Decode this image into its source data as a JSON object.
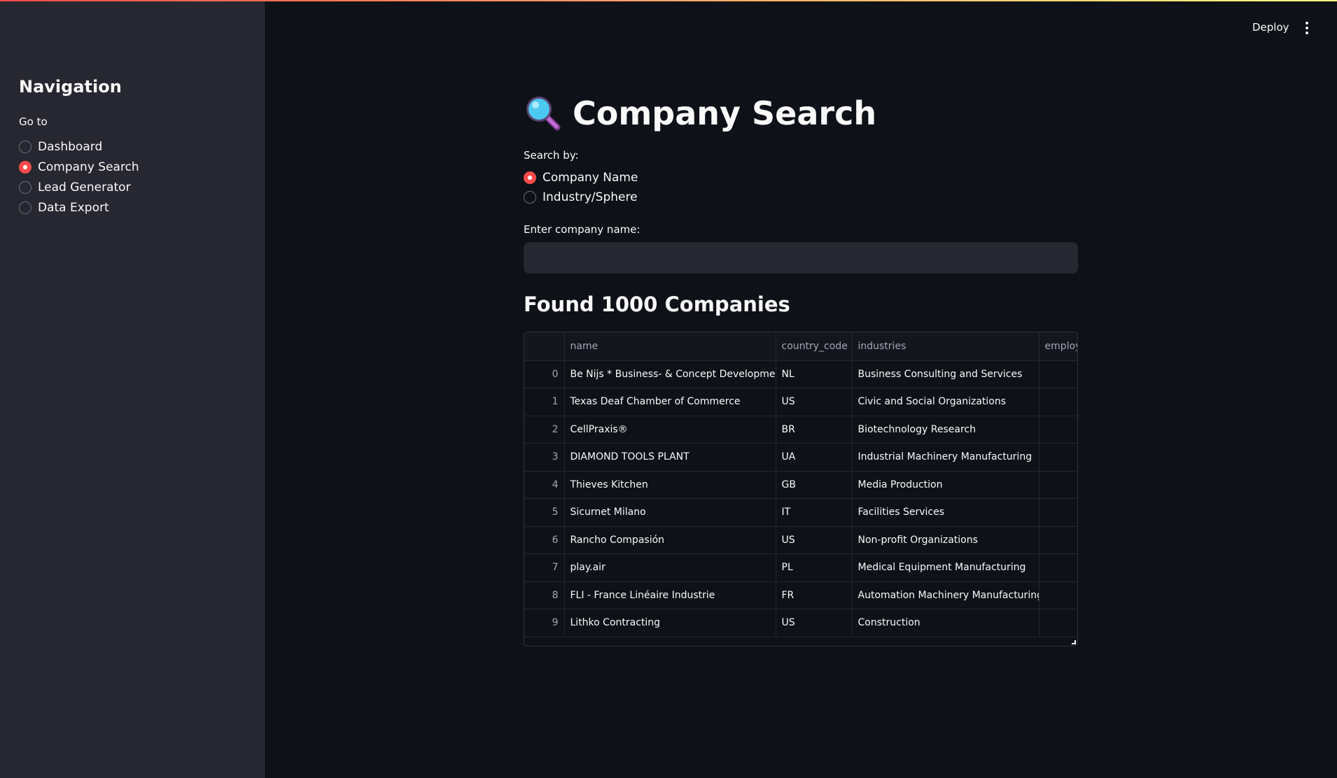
{
  "sidebar": {
    "title": "Navigation",
    "goto_label": "Go to",
    "items": [
      {
        "label": "Dashboard",
        "selected": false
      },
      {
        "label": "Company Search",
        "selected": true
      },
      {
        "label": "Lead Generator",
        "selected": false
      },
      {
        "label": "Data Export",
        "selected": false
      }
    ]
  },
  "toolbar": {
    "deploy_label": "Deploy",
    "menu_icon": "kebab-menu-icon"
  },
  "main": {
    "title": "Company Search",
    "title_icon": "magnifying-glass-icon",
    "search_by_label": "Search by:",
    "search_options": [
      {
        "label": "Company Name",
        "selected": true
      },
      {
        "label": "Industry/Sphere",
        "selected": false
      }
    ],
    "input_label": "Enter company name:",
    "input_value": "",
    "results_heading": "Found 1000 Companies",
    "table": {
      "columns": [
        "",
        "name",
        "country_code",
        "industries",
        "employ"
      ],
      "rows": [
        [
          "0",
          "Be Nijs * Business- & Concept Development",
          "NL",
          "Business Consulting and Services",
          ""
        ],
        [
          "1",
          "Texas Deaf Chamber of Commerce",
          "US",
          "Civic and Social Organizations",
          ""
        ],
        [
          "2",
          "CellPraxis®",
          "BR",
          "Biotechnology Research",
          ""
        ],
        [
          "3",
          "DIAMOND TOOLS PLANT",
          "UA",
          "Industrial Machinery Manufacturing",
          ""
        ],
        [
          "4",
          "Thieves Kitchen",
          "GB",
          "Media Production",
          ""
        ],
        [
          "5",
          "Sicurnet Milano",
          "IT",
          "Facilities Services",
          ""
        ],
        [
          "6",
          "Rancho Compasión",
          "US",
          "Non-profit Organizations",
          ""
        ],
        [
          "7",
          "play.air",
          "PL",
          "Medical Equipment Manufacturing",
          ""
        ],
        [
          "8",
          "FLI - France Linéaire Industrie",
          "FR",
          "Automation Machinery Manufacturing",
          ""
        ],
        [
          "9",
          "Lithko Contracting",
          "US",
          "Construction",
          ""
        ]
      ]
    }
  },
  "colors": {
    "accent": "#ff4b4b",
    "background": "#0e1117",
    "sidebar": "#262730"
  }
}
